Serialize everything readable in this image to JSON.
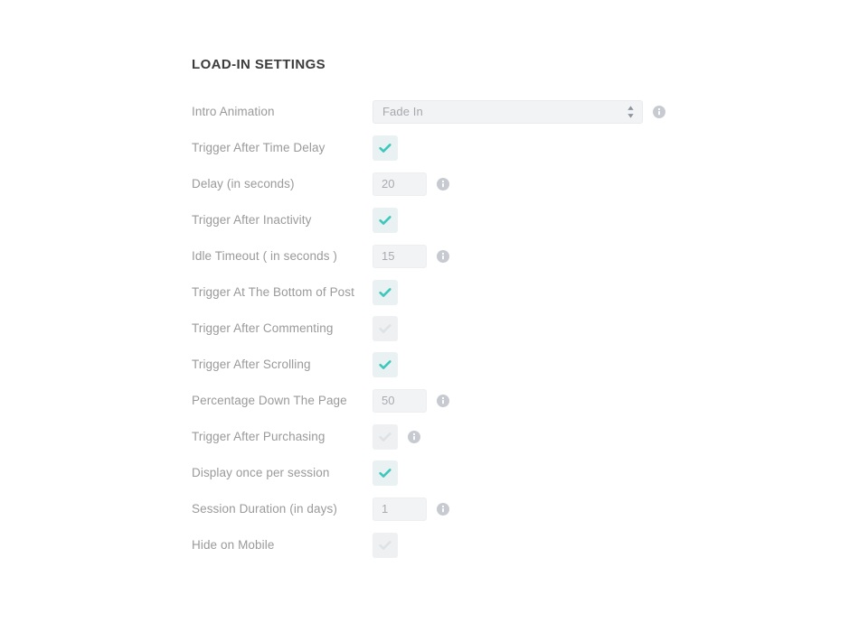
{
  "panel": {
    "title": "LOAD-IN SETTINGS",
    "accent_color": "#3ec8bd",
    "label_color": "#9a9a9a",
    "title_color": "#3c3c3c",
    "field_bg_color": "#f2f3f5",
    "info_icon_color": "#c7cbd1"
  },
  "rows": [
    {
      "label": "Intro Animation",
      "control": "select",
      "value": "Fade In",
      "info": true,
      "icon": "info-icon",
      "control_icon": "stepper-arrows-icon"
    },
    {
      "label": "Trigger After Time Delay",
      "control": "checkbox",
      "checked": true,
      "info": false,
      "icon": "check-icon"
    },
    {
      "label": "Delay (in seconds)",
      "control": "number",
      "value": "20",
      "info": true,
      "icon": "info-icon"
    },
    {
      "label": "Trigger After Inactivity",
      "control": "checkbox",
      "checked": true,
      "info": false,
      "icon": "check-icon"
    },
    {
      "label": "Idle Timeout ( in seconds )",
      "control": "number",
      "value": "15",
      "info": true,
      "icon": "info-icon"
    },
    {
      "label": "Trigger At The Bottom of Post",
      "control": "checkbox",
      "checked": true,
      "info": false,
      "icon": "check-icon"
    },
    {
      "label": "Trigger After Commenting",
      "control": "checkbox",
      "checked": false,
      "info": false,
      "icon": "check-icon"
    },
    {
      "label": "Trigger After Scrolling",
      "control": "checkbox",
      "checked": true,
      "info": false,
      "icon": "check-icon"
    },
    {
      "label": "Percentage Down The Page",
      "control": "number",
      "value": "50",
      "info": true,
      "icon": "info-icon"
    },
    {
      "label": "Trigger After Purchasing",
      "control": "checkbox",
      "checked": false,
      "info": true,
      "icon": "check-icon"
    },
    {
      "label": "Display once per session",
      "control": "checkbox",
      "checked": true,
      "info": false,
      "icon": "check-icon"
    },
    {
      "label": "Session Duration (in days)",
      "control": "number",
      "value": "1",
      "info": true,
      "icon": "info-icon"
    },
    {
      "label": "Hide on Mobile",
      "control": "checkbox",
      "checked": false,
      "info": false,
      "icon": "check-icon"
    }
  ]
}
